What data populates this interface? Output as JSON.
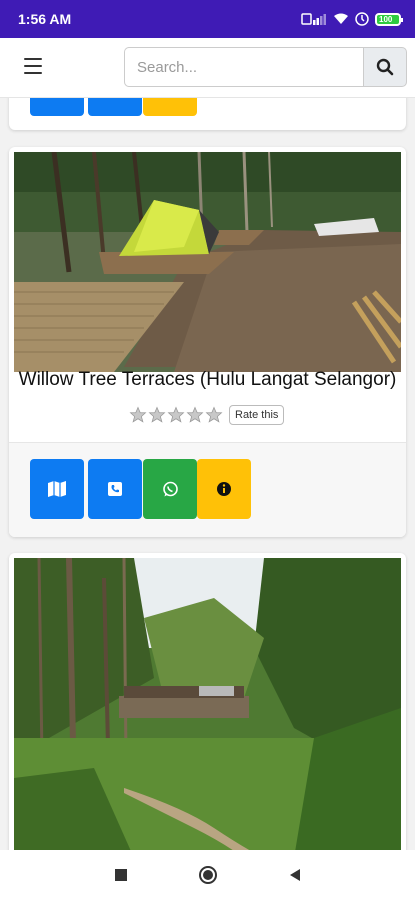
{
  "status_bar": {
    "time": "1:56 AM",
    "battery": "100"
  },
  "header": {
    "search_placeholder": "Search..."
  },
  "cards": [
    {
      "title": "Willow Tree Terraces (Hulu Langat Selangor)",
      "rate_label": "Rate this",
      "rating": 0,
      "max_rating": 5
    }
  ],
  "colors": {
    "primary": "#0d7bf2",
    "success": "#28a745",
    "warning": "#ffc107",
    "status_bar": "#3f1bb5"
  },
  "icons": {
    "map": "map-icon",
    "phone": "phone-icon",
    "whatsapp": "whatsapp-icon",
    "info": "info-icon",
    "search": "search-icon",
    "menu": "hamburger-icon"
  }
}
